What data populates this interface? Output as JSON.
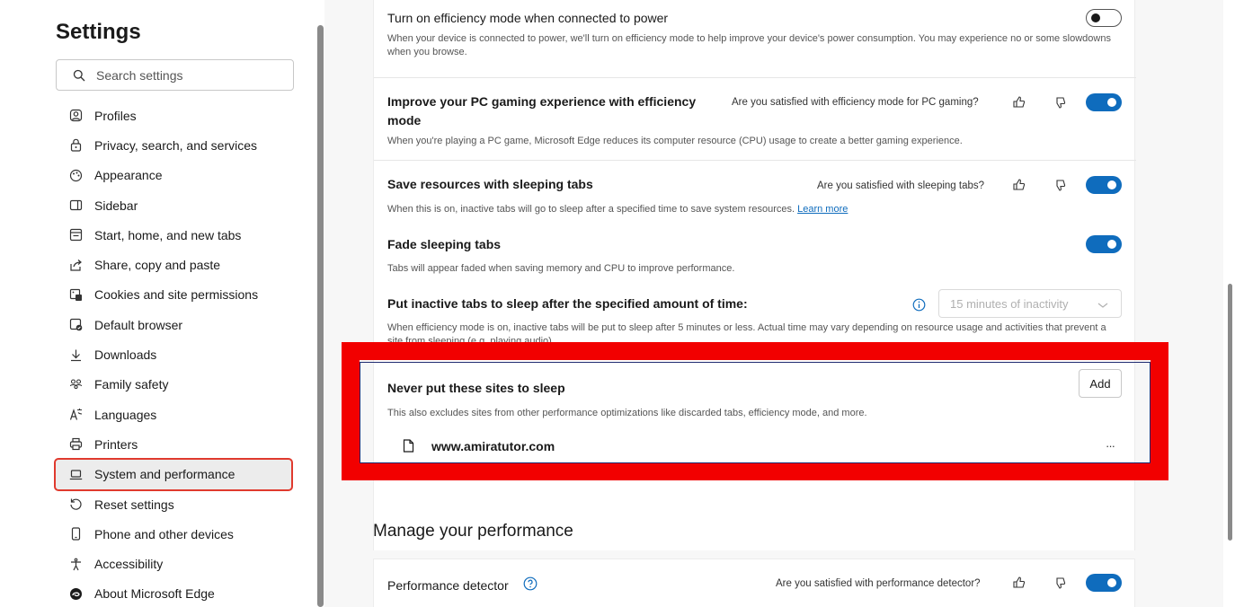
{
  "sidebar": {
    "title": "Settings",
    "search_placeholder": "Search settings",
    "items": [
      {
        "label": "Profiles",
        "icon": "profile-icon"
      },
      {
        "label": "Privacy, search, and services",
        "icon": "lock-icon"
      },
      {
        "label": "Appearance",
        "icon": "palette-icon"
      },
      {
        "label": "Sidebar",
        "icon": "sidebar-icon"
      },
      {
        "label": "Start, home, and new tabs",
        "icon": "home-tabs-icon"
      },
      {
        "label": "Share, copy and paste",
        "icon": "share-icon"
      },
      {
        "label": "Cookies and site permissions",
        "icon": "cookies-icon"
      },
      {
        "label": "Default browser",
        "icon": "default-browser-icon"
      },
      {
        "label": "Downloads",
        "icon": "download-icon"
      },
      {
        "label": "Family safety",
        "icon": "family-icon"
      },
      {
        "label": "Languages",
        "icon": "languages-icon"
      },
      {
        "label": "Printers",
        "icon": "printer-icon"
      },
      {
        "label": "System and performance",
        "icon": "laptop-icon",
        "active": true
      },
      {
        "label": "Reset settings",
        "icon": "reset-icon"
      },
      {
        "label": "Phone and other devices",
        "icon": "phone-icon"
      },
      {
        "label": "Accessibility",
        "icon": "accessibility-icon"
      },
      {
        "label": "About Microsoft Edge",
        "icon": "edge-logo-icon"
      }
    ]
  },
  "main": {
    "efficiency_power": {
      "title": "Turn on efficiency mode when connected to power",
      "desc": "When your device is connected to power, we'll turn on efficiency mode to help improve your device's power consumption. You may experience no or some slowdowns when you browse.",
      "toggle": "off"
    },
    "gaming": {
      "title_line1": "Improve your PC gaming experience with efficiency",
      "title_line2": "mode",
      "feedback": "Are you satisfied with efficiency mode for PC gaming?",
      "desc": "When you're playing a PC game, Microsoft Edge reduces its computer resource (CPU) usage to create a better gaming experience.",
      "toggle": "on"
    },
    "sleeping_tabs": {
      "title": "Save resources with sleeping tabs",
      "feedback": "Are you satisfied with sleeping tabs?",
      "desc": "When this is on, inactive tabs will go to sleep after a specified time to save system resources.",
      "link": "Learn more",
      "toggle": "on"
    },
    "fade_tabs": {
      "title": "Fade sleeping tabs",
      "desc": "Tabs will appear faded when saving memory and CPU to improve performance.",
      "toggle": "on"
    },
    "inactive_sleep": {
      "title": "Put inactive tabs to sleep after the specified amount of time:",
      "dropdown_value": "15 minutes of inactivity",
      "desc": "When efficiency mode is on, inactive tabs will be put to sleep after 5 minutes or less. Actual time may vary depending on resource usage and activities that prevent a site from sleeping (e.g. playing audio)."
    },
    "never_sleep": {
      "title": "Never put these sites to sleep",
      "add_label": "Add",
      "desc": "This also excludes sites from other performance optimizations like discarded tabs, efficiency mode, and more.",
      "site": "www.amiratutor.com",
      "more": "···"
    },
    "manage_section_title": "Manage your performance",
    "performance_detector": {
      "title": "Performance detector",
      "feedback": "Are you satisfied with performance detector?",
      "toggle": "on"
    }
  },
  "colors": {
    "accent": "#0f6cbd",
    "highlight": "#f20000",
    "active_outline": "#e03a2e"
  }
}
